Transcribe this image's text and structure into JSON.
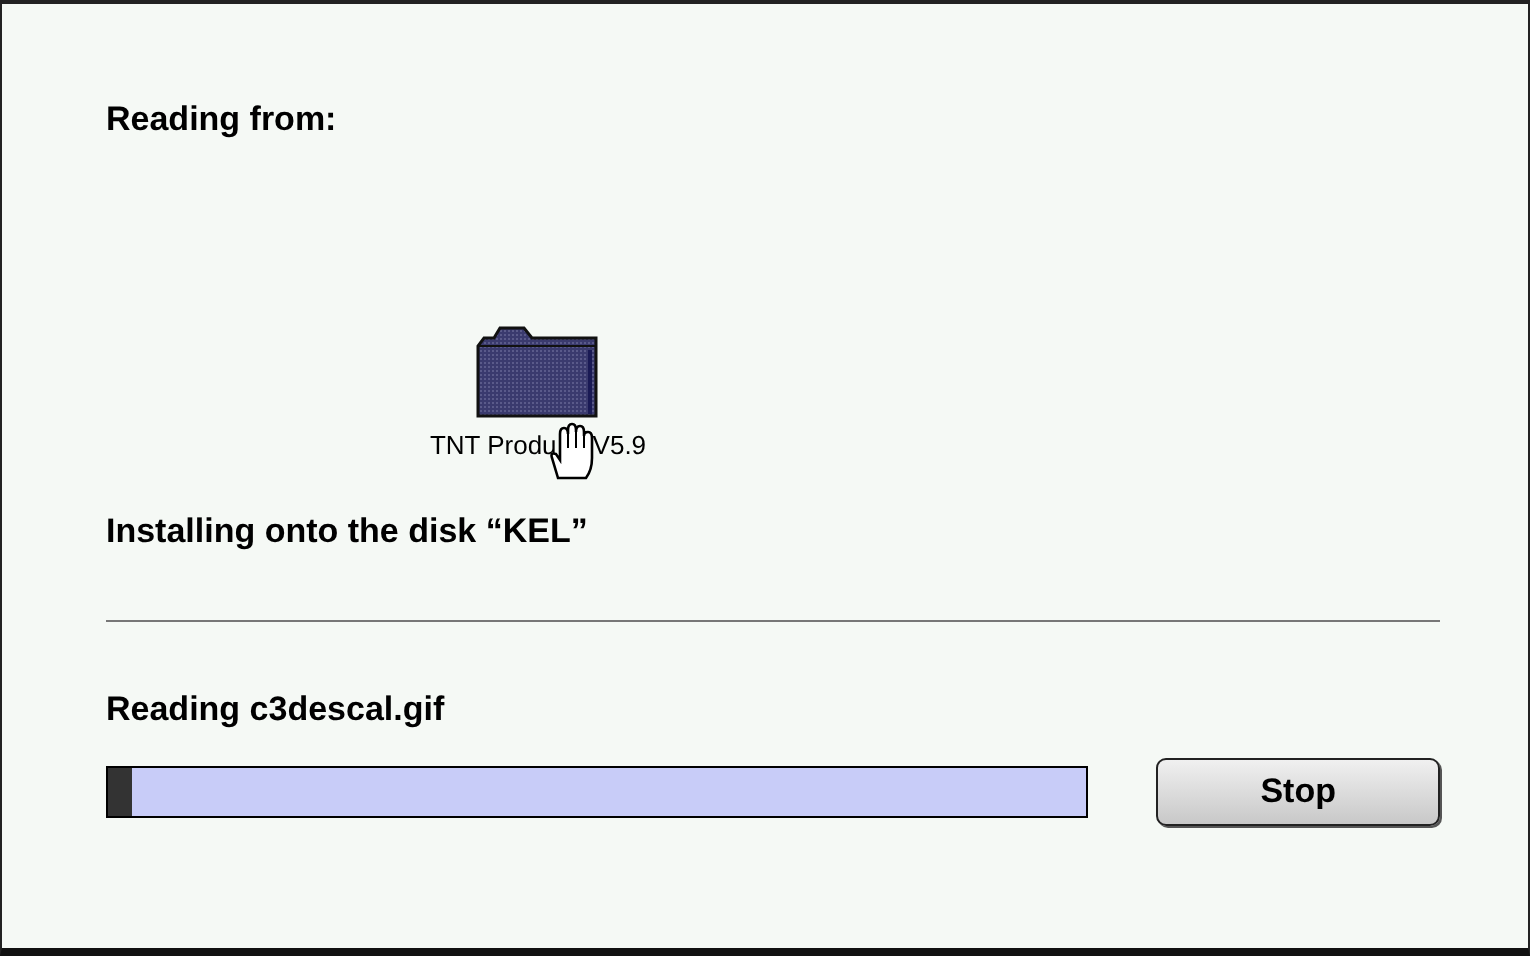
{
  "source": {
    "heading": "Reading from:",
    "item": {
      "label_start": "TNT Produ",
      "label_end": "V5.9"
    }
  },
  "destination": "Installing onto the disk “KEL”",
  "status": "Reading c3descal.gif",
  "progress": {
    "level": 0.025
  },
  "buttons": [
    {
      "label": "Stop"
    }
  ]
}
